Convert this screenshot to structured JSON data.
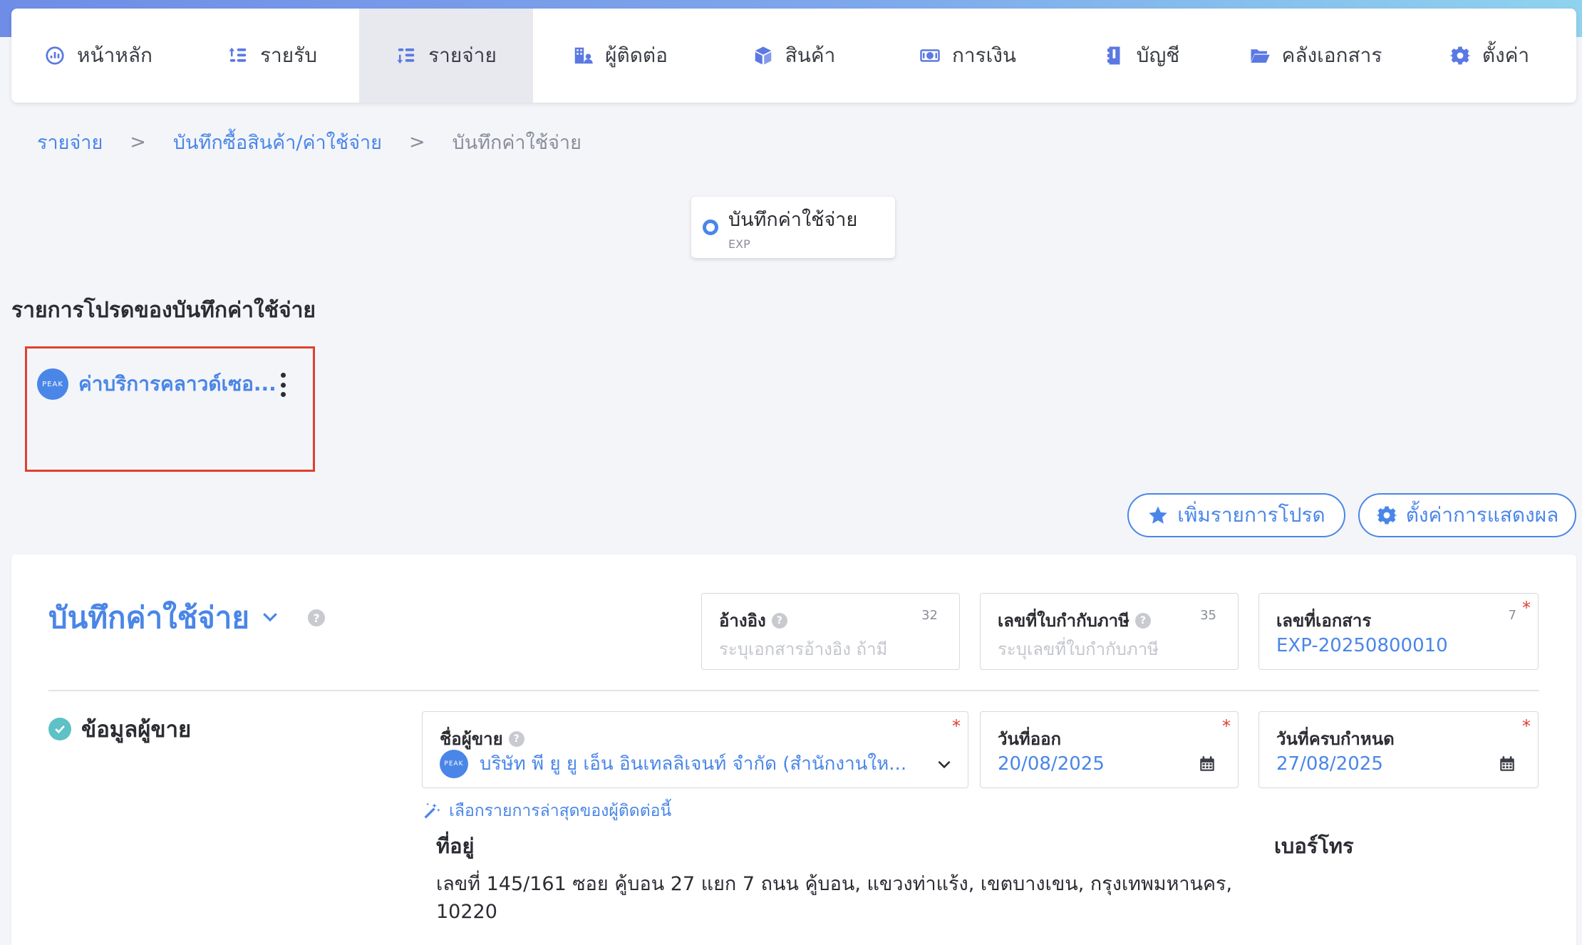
{
  "nav": {
    "items": [
      {
        "label": "หน้าหลัก",
        "icon": "dashboard-icon",
        "active": false
      },
      {
        "label": "รายรับ",
        "icon": "income-icon",
        "active": false
      },
      {
        "label": "รายจ่าย",
        "icon": "expense-icon",
        "active": true
      },
      {
        "label": "ผู้ติดต่อ",
        "icon": "contacts-icon",
        "active": false
      },
      {
        "label": "สินค้า",
        "icon": "box-icon",
        "active": false
      },
      {
        "label": "การเงิน",
        "icon": "money-icon",
        "active": false
      },
      {
        "label": "บัญชี",
        "icon": "book-icon",
        "active": false
      },
      {
        "label": "คลังเอกสาร",
        "icon": "folder-icon",
        "active": false
      },
      {
        "label": "ตั้งค่า",
        "icon": "gear-icon",
        "active": false
      }
    ]
  },
  "breadcrumb": {
    "items": [
      "รายจ่าย",
      "บันทึกซื้อสินค้า/ค่าใช้จ่าย",
      "บันทึกค่าใช้จ่าย"
    ],
    "separator": ">"
  },
  "doc_type": {
    "label": "บันทึกค่าใช้จ่าย",
    "code": "EXP"
  },
  "favorites": {
    "title": "รายการโปรดของบันทึกค่าใช้จ่าย",
    "items": [
      {
        "label": "ค่าบริการคลาวด์เซอ...",
        "logo_text": "PEAK"
      }
    ]
  },
  "actions": {
    "add_favorite": "เพิ่มรายการโปรด",
    "display_settings": "ตั้งค่าการแสดงผล"
  },
  "form": {
    "title": "บันทึกค่าใช้จ่าย",
    "reference": {
      "label": "อ้างอิง",
      "placeholder": "ระบุเอกสารอ้างอิง ถ้ามี",
      "count": "32"
    },
    "tax_invoice": {
      "label": "เลขที่ใบกำกับภาษี",
      "placeholder": "ระบุเลขที่ใบกำกับภาษี",
      "count": "35"
    },
    "document_number": {
      "label": "เลขที่เอกสาร",
      "value": "EXP-20250800010",
      "count": "7",
      "required": "*"
    },
    "vendor_section": {
      "title": "ข้อมูลผู้ขาย"
    },
    "vendor": {
      "label": "ชื่อผู้ขาย",
      "value": "บริษัท พี ยู ยู เอ็น อินเทลลิเจนท์ จำกัด (สำนักงานให...",
      "logo_text": "PEAK",
      "required": "*"
    },
    "issue_date": {
      "label": "วันที่ออก",
      "value": "20/08/2025",
      "required": "*"
    },
    "due_date": {
      "label": "วันที่ครบกำหนด",
      "value": "27/08/2025",
      "required": "*"
    },
    "select_latest": "เลือกรายการล่าสุดของผู้ติดต่อนี้",
    "address": {
      "label": "ที่อยู่",
      "line1": "เลขที่ 145/161 ซอย คู้บอน 27 แยก 7 ถนน คู้บอน, แขวงท่าแร้ง, เขตบางเขน, กรุงเทพมหานคร,",
      "line2": "10220"
    },
    "phone": {
      "label": "เบอร์โทร"
    }
  },
  "colors": {
    "accent": "#4a86e8",
    "required": "#e0402e",
    "highlight_box": "#e0402e",
    "check": "#5dc1c6"
  }
}
